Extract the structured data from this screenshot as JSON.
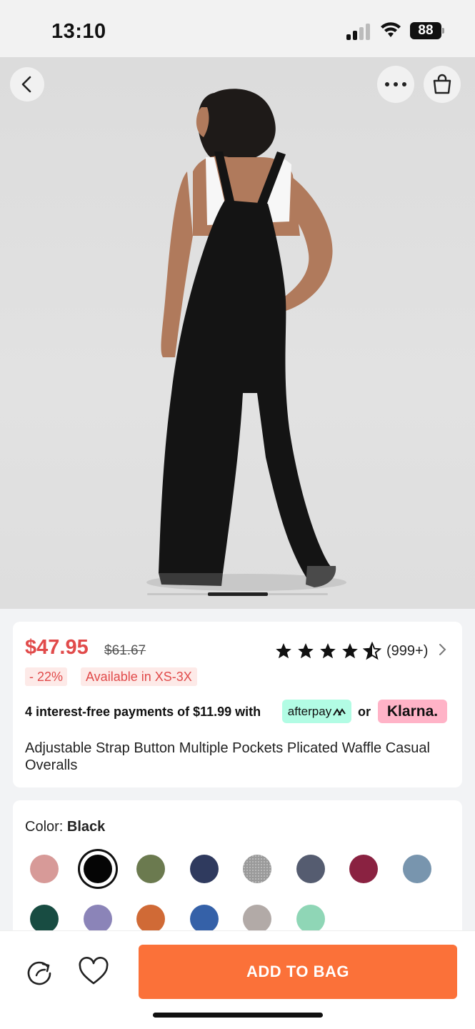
{
  "status_bar": {
    "time": "13:10",
    "battery": "88"
  },
  "product": {
    "price": "$47.95",
    "old_price": "$61.67",
    "rating_count": "(999+)",
    "discount": "- 22%",
    "availability": "Available in XS-3X",
    "payment_text": "4 interest-free payments of $11.99 with",
    "afterpay_label": "afterpay",
    "or_label": "or",
    "klarna_label": "Klarna.",
    "title": "Adjustable Strap Button Multiple Pockets Plicated Waffle Casual Overalls",
    "rating_stars": 4.5
  },
  "colors": {
    "label": "Color:",
    "selected_name": "Black",
    "swatches": [
      "#d79a98",
      "#050505",
      "#6b7a4f",
      "#2f3a5e",
      "#9a9a9a",
      "#555c70",
      "#8a2241",
      "#7895ae",
      "#184c42",
      "#8b84b8",
      "#d06a36",
      "#3561a8",
      "#b2aaa7",
      "#8fd6b6"
    ]
  },
  "actions": {
    "add_to_bag": "ADD TO BAG"
  },
  "theme": {
    "accent": "#fb7139",
    "sale": "#e14b4b"
  }
}
